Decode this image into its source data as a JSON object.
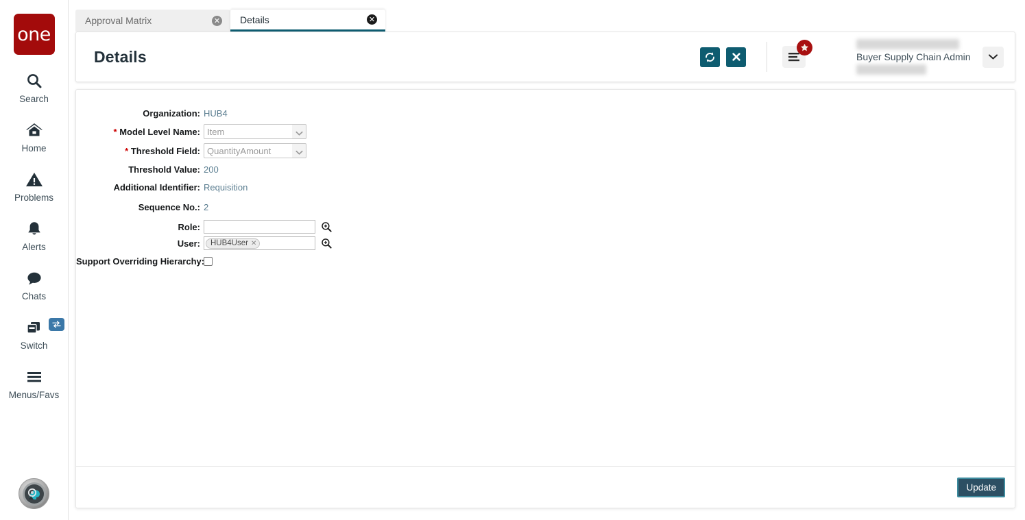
{
  "brand": {
    "logo_text": "one",
    "logo_color": "#a30b0b"
  },
  "sidebar": {
    "items": [
      {
        "label": "Search",
        "icon": "search-icon"
      },
      {
        "label": "Home",
        "icon": "home-icon"
      },
      {
        "label": "Problems",
        "icon": "warning-triangle-icon"
      },
      {
        "label": "Alerts",
        "icon": "bell-icon"
      },
      {
        "label": "Chats",
        "icon": "chat-bubble-icon"
      },
      {
        "label": "Switch",
        "icon": "switch-windows-icon",
        "badge_icon": "swap-arrows-icon"
      },
      {
        "label": "Menus/Favs",
        "icon": "hamburger-icon"
      }
    ],
    "assistant_avatar": "ai-assistant-avatar"
  },
  "tabs": [
    {
      "label": "Approval Matrix",
      "active": false,
      "close_icon": "close-circle-icon"
    },
    {
      "label": "Details",
      "active": true,
      "close_icon": "close-circle-icon"
    }
  ],
  "header": {
    "title": "Details",
    "refresh_icon": "refresh-icon",
    "close_icon": "close-x-icon",
    "menu_icon": "hamburger-menu-icon",
    "favorites_badge_icon": "star-icon",
    "user_role": "Buyer Supply Chain Admin",
    "caret_icon": "chevron-down-icon",
    "accent_color": "#0e5c70",
    "badge_color": "#a81010"
  },
  "form": {
    "fields": [
      {
        "label": "Organization",
        "required": false,
        "type": "text",
        "value": "HUB4"
      },
      {
        "label": "Model Level Name",
        "required": true,
        "type": "select",
        "value": "Item"
      },
      {
        "label": "Threshold Field",
        "required": true,
        "type": "select",
        "value": "QuantityAmount"
      },
      {
        "label": "Threshold Value",
        "required": false,
        "type": "text",
        "value": "200"
      },
      {
        "label": "Additional Identifier",
        "required": false,
        "type": "text",
        "value": "Requisition"
      },
      {
        "label": "Sequence No.",
        "required": false,
        "type": "text",
        "value": "2"
      },
      {
        "label": "Role",
        "required": false,
        "type": "input",
        "value": "",
        "lookup_icon": "search-magnifier-icon"
      },
      {
        "label": "User",
        "required": false,
        "type": "chip",
        "value": "HUB4User",
        "chip_remove_icon": "remove-x-icon",
        "lookup_icon": "search-magnifier-icon"
      },
      {
        "label": "Support Overriding Hierarchy",
        "required": false,
        "type": "checkbox",
        "checked": false
      }
    ]
  },
  "footer": {
    "update_label": "Update"
  }
}
